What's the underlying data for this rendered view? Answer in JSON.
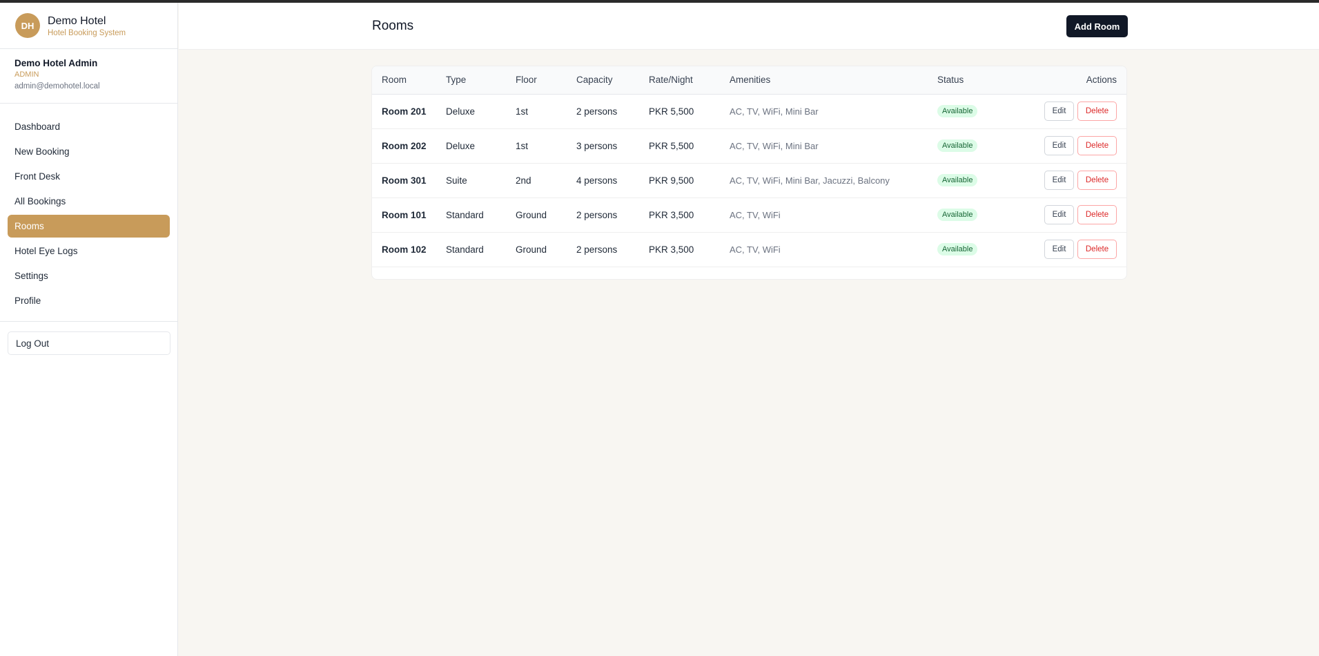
{
  "app": {
    "avatar_initials": "DH",
    "name": "Demo Hotel",
    "subtitle": "Hotel Booking System"
  },
  "user": {
    "name": "Demo Hotel Admin",
    "role": "ADMIN",
    "email": "admin@demohotel.local"
  },
  "nav": {
    "items": [
      {
        "label": "Dashboard"
      },
      {
        "label": "New Booking"
      },
      {
        "label": "Front Desk"
      },
      {
        "label": "All Bookings"
      },
      {
        "label": "Rooms",
        "active": true
      },
      {
        "label": "Hotel Eye Logs"
      },
      {
        "label": "Settings"
      },
      {
        "label": "Profile"
      }
    ],
    "logout_label": "Log Out"
  },
  "header": {
    "title": "Rooms",
    "add_room_label": "Add Room"
  },
  "table": {
    "columns": [
      "Room",
      "Type",
      "Floor",
      "Capacity",
      "Rate/Night",
      "Amenities",
      "Status",
      "Actions"
    ],
    "rows": [
      {
        "room": "Room 201",
        "type": "Deluxe",
        "floor": "1st",
        "capacity": "2 persons",
        "rate": "PKR 5,500",
        "amenities": "AC, TV, WiFi, Mini Bar",
        "status": "Available"
      },
      {
        "room": "Room 202",
        "type": "Deluxe",
        "floor": "1st",
        "capacity": "3 persons",
        "rate": "PKR 5,500",
        "amenities": "AC, TV, WiFi, Mini Bar",
        "status": "Available"
      },
      {
        "room": "Room 301",
        "type": "Suite",
        "floor": "2nd",
        "capacity": "4 persons",
        "rate": "PKR 9,500",
        "amenities": "AC, TV, WiFi, Mini Bar, Jacuzzi, Balcony",
        "status": "Available"
      },
      {
        "room": "Room 101",
        "type": "Standard",
        "floor": "Ground",
        "capacity": "2 persons",
        "rate": "PKR 3,500",
        "amenities": "AC, TV, WiFi",
        "status": "Available"
      },
      {
        "room": "Room 102",
        "type": "Standard",
        "floor": "Ground",
        "capacity": "2 persons",
        "rate": "PKR 3,500",
        "amenities": "AC, TV, WiFi",
        "status": "Available"
      }
    ],
    "edit_label": "Edit",
    "delete_label": "Delete"
  },
  "colors": {
    "accent": "#c89b5a",
    "primary_button": "#111827",
    "status_available_bg": "#dcfce7",
    "status_available_text": "#166534",
    "danger": "#dc2626"
  }
}
